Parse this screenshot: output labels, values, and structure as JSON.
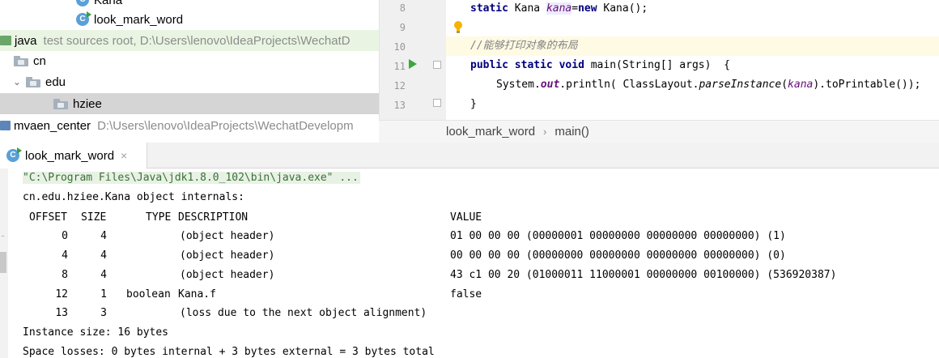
{
  "project_tree": {
    "items": [
      {
        "label": "Kana",
        "hint": ""
      },
      {
        "label": "look_mark_word",
        "hint": ""
      },
      {
        "label": "java",
        "hint": "test sources root,  D:\\Users\\lenovo\\IdeaProjects\\WechatD"
      },
      {
        "label": "cn",
        "hint": ""
      },
      {
        "label": "edu",
        "hint": ""
      },
      {
        "label": "hziee",
        "hint": ""
      },
      {
        "label": "mvaen_center",
        "hint": "D:\\Users\\lenovo\\IdeaProjects\\WechatDevelopm"
      }
    ]
  },
  "editor": {
    "line_numbers": [
      "8",
      "9",
      "10",
      "11",
      "12",
      "13"
    ],
    "line8": {
      "kw1": "static",
      "type": " Kana ",
      "var": "kana",
      "eq": "=",
      "kw2": "new",
      "rest": " Kana();"
    },
    "line10": {
      "comment": "//能够打印对象的布局"
    },
    "line11": {
      "kw1": "public",
      "kw2": "static",
      "kw3": "void",
      "rest": " main(String[] args)  {"
    },
    "line12": {
      "a": "System.",
      "out": "out",
      "b": ".println( ClassLayout.",
      "m": "parseInstance",
      "c": "(",
      "var": "kana",
      "d": ").toPrintable());"
    },
    "line13": {
      "text": "}"
    }
  },
  "breadcrumb": {
    "file": "look_mark_word",
    "sep": "›",
    "method": "main()"
  },
  "run_panel": {
    "tab_label": "look_mark_word",
    "close_glyph": "×",
    "command": "\"C:\\Program Files\\Java\\jdk1.8.0_102\\bin\\java.exe\" ...",
    "internals": "cn.edu.hziee.Kana object internals:",
    "header": {
      "offset": "OFFSET",
      "size": "SIZE",
      "type": "TYPE",
      "description": "DESCRIPTION",
      "value": "VALUE"
    },
    "rows": [
      {
        "offset": "0",
        "size": "4",
        "type": "",
        "description": "(object header)",
        "value": "01 00 00 00 (00000001 00000000 00000000 00000000) (1)"
      },
      {
        "offset": "4",
        "size": "4",
        "type": "",
        "description": "(object header)",
        "value": "00 00 00 00 (00000000 00000000 00000000 00000000) (0)"
      },
      {
        "offset": "8",
        "size": "4",
        "type": "",
        "description": "(object header)",
        "value": "43 c1 00 20 (01000011 11000001 00000000 00100000) (536920387)"
      },
      {
        "offset": "12",
        "size": "1",
        "type": "boolean",
        "description": "Kana.f",
        "value": "false"
      },
      {
        "offset": "13",
        "size": "3",
        "type": "",
        "description": "(loss due to the next object alignment)",
        "value": ""
      }
    ],
    "instance_size": "Instance size: 16 bytes",
    "space_losses": "Space losses: 0 bytes internal + 3 bytes external = 3 bytes total"
  }
}
